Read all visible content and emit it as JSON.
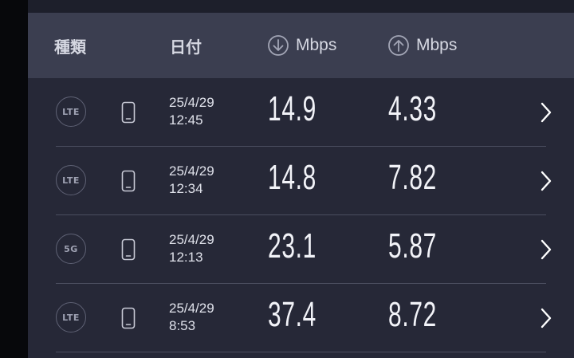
{
  "header": {
    "type_label": "種類",
    "date_label": "日付",
    "download_unit": "Mbps",
    "upload_unit": "Mbps"
  },
  "icons": {
    "download": "arrow-down-circle-icon",
    "upload": "arrow-up-circle-icon",
    "device": "smartphone-icon",
    "detail": "chevron-right-icon"
  },
  "colors": {
    "background": "#262837",
    "header": "#3b3e50",
    "text": "#f2f3f8"
  },
  "results": [
    {
      "network": "LTE",
      "date": "25/4/29",
      "time": "12:45",
      "download": "14.9",
      "upload": "4.33"
    },
    {
      "network": "LTE",
      "date": "25/4/29",
      "time": "12:34",
      "download": "14.8",
      "upload": "7.82"
    },
    {
      "network": "5G",
      "date": "25/4/29",
      "time": "12:13",
      "download": "23.1",
      "upload": "5.87"
    },
    {
      "network": "LTE",
      "date": "25/4/29",
      "time": "8:53",
      "download": "37.4",
      "upload": "8.72"
    }
  ]
}
